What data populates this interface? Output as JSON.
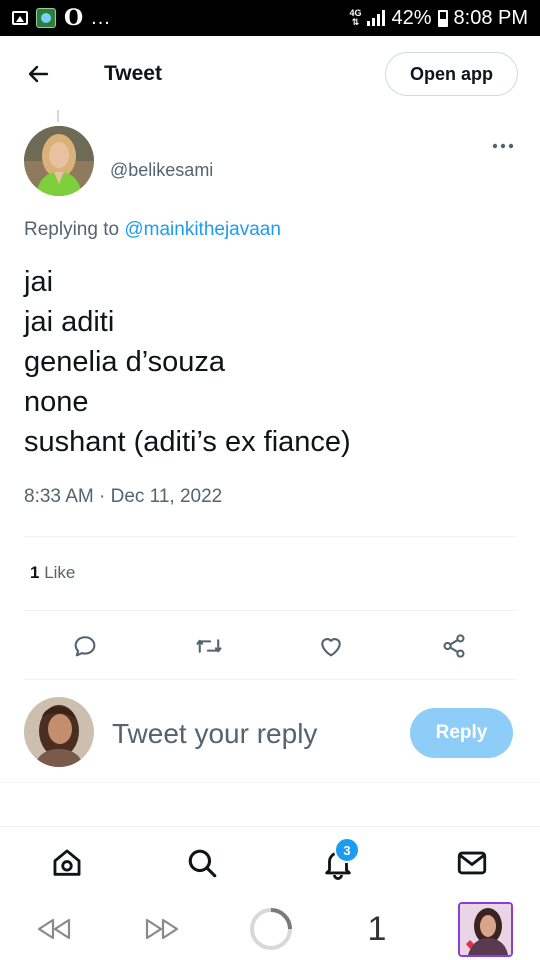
{
  "status_bar": {
    "network": "4G",
    "battery": "42%",
    "time": "8:08 PM",
    "overflow": "..."
  },
  "header": {
    "title": "Tweet",
    "open_app_label": "Open app"
  },
  "tweet": {
    "handle": "@belikesami",
    "replying_prefix": "Replying to",
    "replying_to": "@mainkithejavaan",
    "lines": [
      "jai",
      "jai aditi",
      "genelia d’souza",
      "none",
      "sushant (aditi’s ex fiance)"
    ],
    "timestamp": "8:33 AM · Dec 11, 2022",
    "like_count": "1",
    "like_label": "Like"
  },
  "actions": [
    "reply-icon",
    "retweet-icon",
    "heart-icon",
    "share-icon"
  ],
  "reply_bar": {
    "placeholder": "Tweet your reply",
    "button_label": "Reply"
  },
  "bottom_nav": {
    "items": [
      "home-icon",
      "search-icon",
      "notifications-icon",
      "messages-icon"
    ],
    "notification_count": "3"
  },
  "browser_bar": {
    "tab_count": "1"
  },
  "colors": {
    "accent": "#1d9bf0",
    "reply_button_disabled": "#8ecdf8",
    "secondary_text": "#536471",
    "primary_text": "#0f1419"
  }
}
